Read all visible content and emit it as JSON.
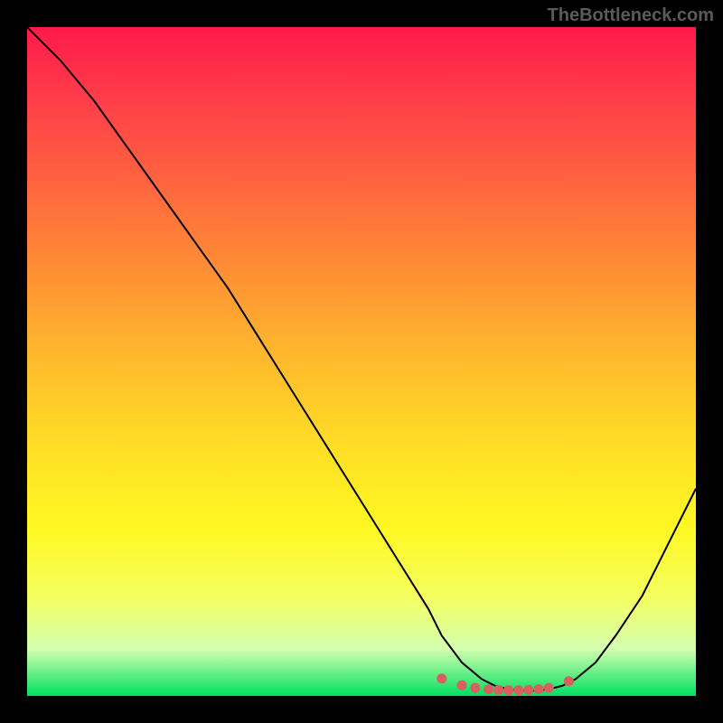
{
  "watermark": "TheBottleneck.com",
  "chart_data": {
    "type": "line",
    "title": "",
    "xlabel": "",
    "ylabel": "",
    "xlim": [
      0,
      100
    ],
    "ylim": [
      0,
      100
    ],
    "series": [
      {
        "name": "bottleneck-curve",
        "x": [
          0,
          5,
          10,
          15,
          20,
          25,
          30,
          35,
          40,
          45,
          50,
          55,
          60,
          62,
          65,
          68,
          70,
          72,
          74,
          76,
          78,
          80,
          82,
          85,
          88,
          92,
          96,
          100
        ],
        "y": [
          100,
          95,
          89,
          82,
          75,
          68,
          61,
          53,
          45,
          37,
          29,
          21,
          13,
          9,
          5,
          2.5,
          1.5,
          1,
          0.8,
          0.8,
          1,
          1.5,
          2.5,
          5,
          9,
          15,
          23,
          31
        ]
      },
      {
        "name": "bottom-markers",
        "x": [
          62,
          65,
          67,
          69,
          70.5,
          72,
          73.5,
          75,
          76.5,
          78,
          81
        ],
        "y": [
          2.6,
          1.6,
          1.2,
          1.0,
          0.9,
          0.85,
          0.85,
          0.9,
          1.0,
          1.2,
          2.2
        ]
      }
    ],
    "colors": {
      "gradient_top": "#ff1a4a",
      "gradient_bottom": "#00e060",
      "curve": "#000000",
      "markers": "#d9605f"
    }
  }
}
